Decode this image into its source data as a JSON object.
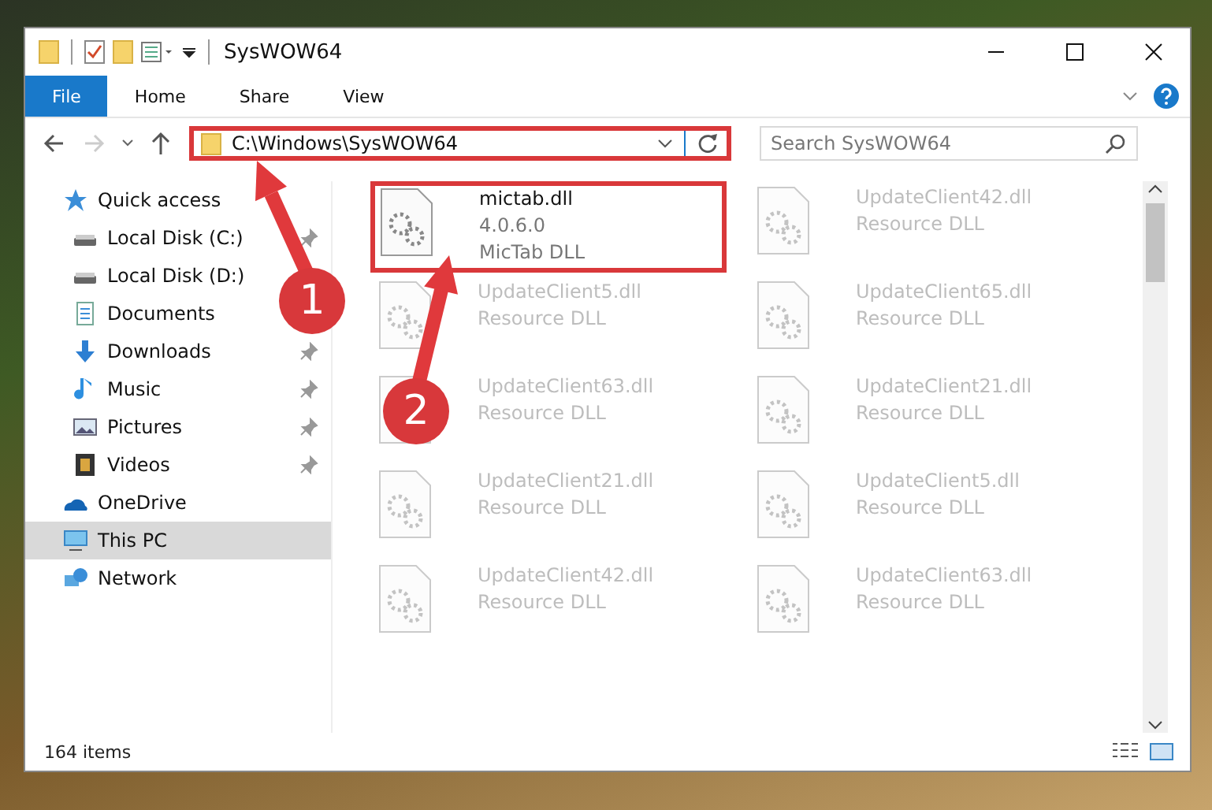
{
  "window": {
    "title": "SysWOW64"
  },
  "ribbon_tabs": [
    {
      "label": "File",
      "selected": true
    },
    {
      "label": "Home",
      "selected": false
    },
    {
      "label": "Share",
      "selected": false
    },
    {
      "label": "View",
      "selected": false
    }
  ],
  "address": {
    "path": "C:\\Windows\\SysWOW64",
    "highlighted": true
  },
  "search": {
    "placeholder": "Search SysWOW64"
  },
  "sidebar": {
    "items": [
      {
        "label": "Quick access",
        "selected": false,
        "children": [
          {
            "label": "Local Disk (C:)",
            "pinned": true,
            "selected": false
          },
          {
            "label": "Local Disk (D:)",
            "pinned": false,
            "selected": false
          },
          {
            "label": "Documents",
            "pinned": false,
            "selected": false
          },
          {
            "label": "Downloads",
            "pinned": true,
            "selected": false
          },
          {
            "label": "Music",
            "pinned": true,
            "selected": false
          },
          {
            "label": "Pictures",
            "pinned": true,
            "selected": false
          },
          {
            "label": "Videos",
            "pinned": true,
            "selected": false
          }
        ]
      },
      {
        "label": "OneDrive",
        "selected": false
      },
      {
        "label": "This PC",
        "selected": true
      },
      {
        "label": "Network",
        "selected": false
      }
    ]
  },
  "files": [
    {
      "name": "mictab.dll",
      "lines": [
        "4.0.6.0",
        "MicTab DLL"
      ],
      "highlighted": true,
      "blurred": false
    },
    {
      "name": "UpdateClient42.dll",
      "lines": [
        "Resource DLL"
      ],
      "highlighted": false,
      "blurred": true
    },
    {
      "name": "UpdateClient5.dll",
      "lines": [
        "Resource DLL"
      ],
      "highlighted": false,
      "blurred": true
    },
    {
      "name": "UpdateClient65.dll",
      "lines": [
        "Resource DLL"
      ],
      "highlighted": false,
      "blurred": true
    },
    {
      "name": "UpdateClient63.dll",
      "lines": [
        "Resource DLL"
      ],
      "highlighted": false,
      "blurred": true
    },
    {
      "name": "UpdateClient21.dll",
      "lines": [
        "Resource DLL"
      ],
      "highlighted": false,
      "blurred": true
    },
    {
      "name": "UpdateClient21.dll",
      "lines": [
        "Resource DLL"
      ],
      "highlighted": false,
      "blurred": true
    },
    {
      "name": "UpdateClient5.dll",
      "lines": [
        "Resource DLL"
      ],
      "highlighted": false,
      "blurred": true
    },
    {
      "name": "UpdateClient42.dll",
      "lines": [
        "Resource DLL"
      ],
      "highlighted": false,
      "blurred": true
    },
    {
      "name": "UpdateClient63.dll",
      "lines": [
        "Resource DLL"
      ],
      "highlighted": false,
      "blurred": true
    }
  ],
  "status_bar": {
    "item_count": "164 items"
  },
  "annotations": [
    {
      "label": "1"
    },
    {
      "label": "2"
    }
  ]
}
